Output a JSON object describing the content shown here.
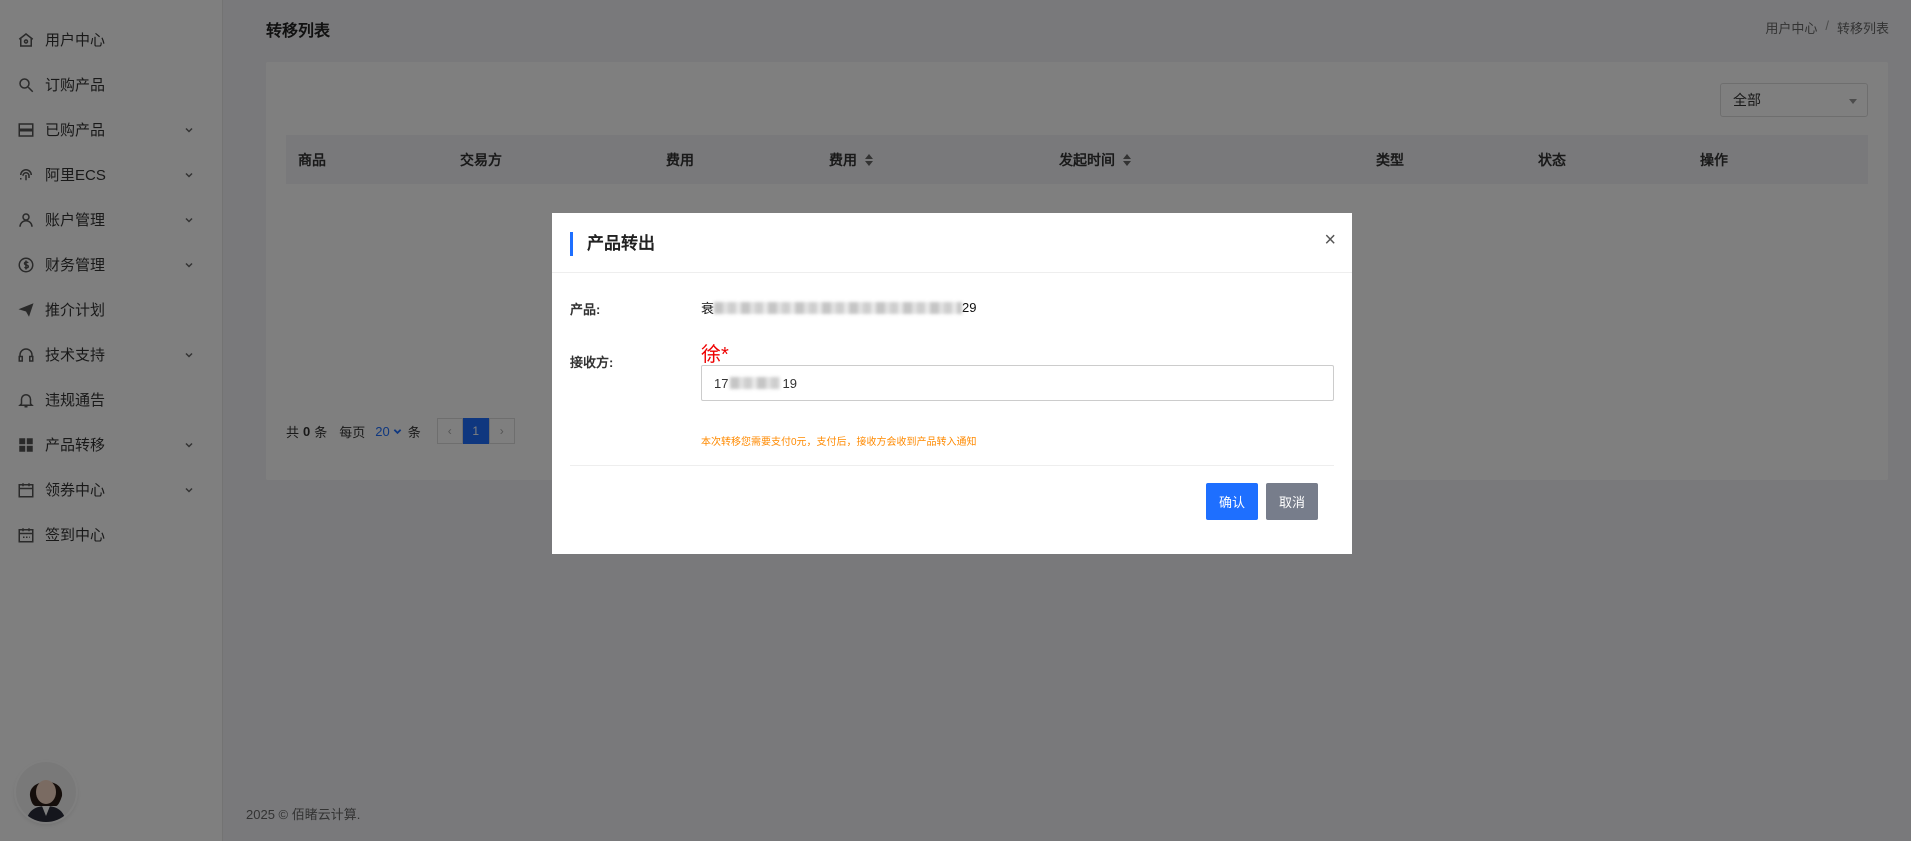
{
  "sidebar": {
    "items": [
      {
        "label": "用户中心",
        "icon": "home-icon",
        "expandable": false
      },
      {
        "label": "订购产品",
        "icon": "search-icon",
        "expandable": false
      },
      {
        "label": "已购产品",
        "icon": "server-icon",
        "expandable": true
      },
      {
        "label": "阿里ECS",
        "icon": "fingerprint-icon",
        "expandable": true
      },
      {
        "label": "账户管理",
        "icon": "user-icon",
        "expandable": true
      },
      {
        "label": "财务管理",
        "icon": "dollar-icon",
        "expandable": true
      },
      {
        "label": "推介计划",
        "icon": "send-icon",
        "expandable": false
      },
      {
        "label": "技术支持",
        "icon": "headset-icon",
        "expandable": true
      },
      {
        "label": "违规通告",
        "icon": "bell-icon",
        "expandable": false
      },
      {
        "label": "产品转移",
        "icon": "grid-icon",
        "expandable": true
      },
      {
        "label": "领券中心",
        "icon": "calendar-icon",
        "expandable": true
      },
      {
        "label": "签到中心",
        "icon": "calendar-check-icon",
        "expandable": false
      }
    ]
  },
  "header": {
    "title": "转移列表",
    "breadcrumb": [
      "用户中心",
      "/",
      "转移列表"
    ]
  },
  "filter": {
    "selected": "全部"
  },
  "table": {
    "columns": [
      "商品",
      "交易方",
      "费用",
      "费用",
      "发起时间",
      "类型",
      "状态",
      "操作"
    ]
  },
  "pager": {
    "total_prefix": "共",
    "total": "0",
    "total_suffix": "条",
    "per_page_label": "每页",
    "per_page": "20",
    "per_page_suffix": "条",
    "prev": "‹",
    "current": "1",
    "next": "›"
  },
  "footer": {
    "text": "2025 © 佰睹云计算."
  },
  "modal": {
    "title": "产品转出",
    "close": "×",
    "product_label": "产品:",
    "product_prefix": "衰",
    "product_suffix": "29",
    "receiver_label": "接收方:",
    "receiver_name": "徐*",
    "receiver_value_prefix": "17",
    "receiver_value_suffix": "19",
    "hint": "本次转移您需要支付0元，支付后，接收方会收到产品转入通知",
    "confirm": "确认",
    "cancel": "取消"
  },
  "colors": {
    "primary": "#1e6fff",
    "warning": "#ff8a00",
    "danger": "#e00000",
    "cancel": "#777d8b"
  }
}
